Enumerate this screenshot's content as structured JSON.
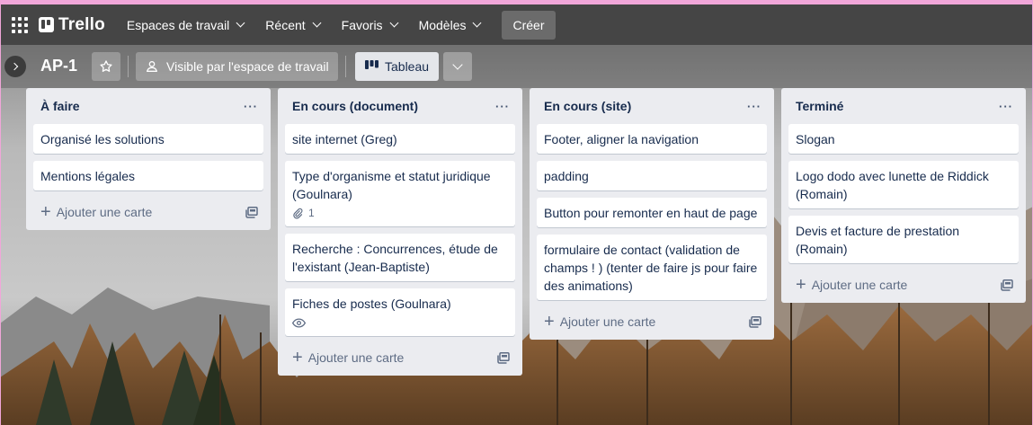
{
  "header": {
    "logo_text": "Trello",
    "nav": [
      {
        "label": "Espaces de travail"
      },
      {
        "label": "Récent"
      },
      {
        "label": "Favoris"
      },
      {
        "label": "Modèles"
      }
    ],
    "create_label": "Créer"
  },
  "board": {
    "title": "AP-1",
    "visibility_label": "Visible par l'espace de travail",
    "view_label": "Tableau"
  },
  "lists": [
    {
      "title": "À faire",
      "menu_label": "···",
      "cards": [
        {
          "title": "Organisé les solutions"
        },
        {
          "title": "Mentions légales"
        }
      ],
      "add_label": "Ajouter une carte"
    },
    {
      "title": "En cours (document)",
      "menu_label": "···",
      "cards": [
        {
          "title": "site internet (Greg)"
        },
        {
          "title": "Type d'organisme et statut juridique (Goulnara)",
          "attachments": "1"
        },
        {
          "title": "Recherche : Concurrences, étude de l'existant (Jean-Baptiste)"
        },
        {
          "title": "Fiches de postes (Goulnara)",
          "watched": true
        }
      ],
      "add_label": "Ajouter une carte"
    },
    {
      "title": "En cours (site)",
      "menu_label": "···",
      "cards": [
        {
          "title": "Footer, aligner la navigation"
        },
        {
          "title": "padding"
        },
        {
          "title": "Button pour remonter en haut de page"
        },
        {
          "title": "formulaire de contact (validation de champs ! ) (tenter de faire js pour faire des animations)"
        }
      ],
      "add_label": "Ajouter une carte"
    },
    {
      "title": "Terminé",
      "menu_label": "···",
      "cards": [
        {
          "title": "Slogan"
        },
        {
          "title": "Logo dodo avec lunette de Riddick (Romain)"
        },
        {
          "title": "Devis et facture de prestation (Romain)"
        }
      ],
      "add_label": "Ajouter une carte"
    }
  ],
  "colors": {
    "header_bg": "#454545",
    "list_bg": "#ebecf0",
    "accent_pink": "#f0a6d9"
  },
  "icons": [
    "apps-grid-icon",
    "trello-logo-icon",
    "chevron-down-icon",
    "chevron-right-icon",
    "star-icon",
    "people-icon",
    "board-view-icon",
    "attachment-icon",
    "eye-icon",
    "template-icon",
    "plus-icon"
  ]
}
